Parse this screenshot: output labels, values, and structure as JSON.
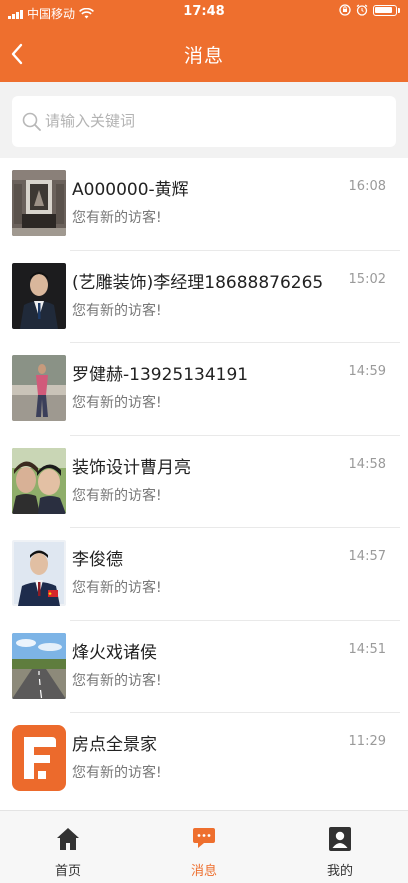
{
  "status_bar": {
    "carrier": "中国移动",
    "time": "17:48"
  },
  "nav": {
    "title": "消息"
  },
  "search": {
    "placeholder": "请输入关键词",
    "value": ""
  },
  "messages": [
    {
      "name": "A000000-黄辉",
      "time": "16:08",
      "preview": "您有新的访客!"
    },
    {
      "name": "(艺雕装饰)李经理18688876265",
      "time": "15:02",
      "preview": "您有新的访客!"
    },
    {
      "name": "罗健赫-13925134191",
      "time": "14:59",
      "preview": "您有新的访客!"
    },
    {
      "name": "装饰设计曹月亮",
      "time": "14:58",
      "preview": "您有新的访客!"
    },
    {
      "name": "李俊德",
      "time": "14:57",
      "preview": "您有新的访客!"
    },
    {
      "name": "烽火戏诸侯",
      "time": "14:51",
      "preview": "您有新的访客!"
    },
    {
      "name": "房点全景家",
      "time": "11:29",
      "preview": "您有新的访客!"
    }
  ],
  "tab_bar": {
    "tabs": [
      {
        "label": "首页",
        "icon": "home-icon",
        "active": false
      },
      {
        "label": "消息",
        "icon": "chat-icon",
        "active": true
      },
      {
        "label": "我的",
        "icon": "profile-icon",
        "active": false
      }
    ]
  },
  "colors": {
    "accent": "#ee6f2e",
    "tab_inactive": "#333333"
  }
}
